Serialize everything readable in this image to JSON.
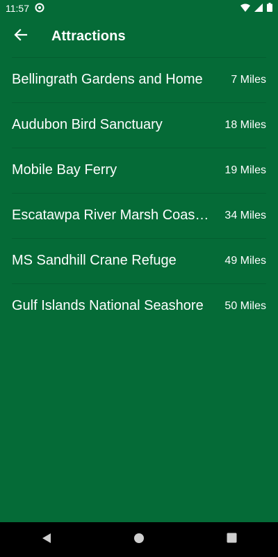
{
  "status_bar": {
    "time": "11:57"
  },
  "app_bar": {
    "title": "Attractions"
  },
  "attractions": [
    {
      "name": "Bellingrath Gardens and Home",
      "distance": "7 Miles"
    },
    {
      "name": "Audubon Bird Sanctuary",
      "distance": "18 Miles"
    },
    {
      "name": "Mobile Bay Ferry",
      "distance": "19 Miles"
    },
    {
      "name": "Escatawpa River Marsh Coastal Preserve",
      "distance": "34 Miles"
    },
    {
      "name": "MS Sandhill Crane Refuge",
      "distance": "49 Miles"
    },
    {
      "name": "Gulf Islands National Seashore",
      "distance": "50 Miles"
    }
  ],
  "icons": {
    "back": "arrow-back-icon",
    "nav_back": "triangle-back-icon",
    "nav_home": "circle-home-icon",
    "nav_recents": "square-recents-icon"
  },
  "colors": {
    "background": "#056b37",
    "nav_bar": "#000000",
    "text": "#ffffff"
  }
}
